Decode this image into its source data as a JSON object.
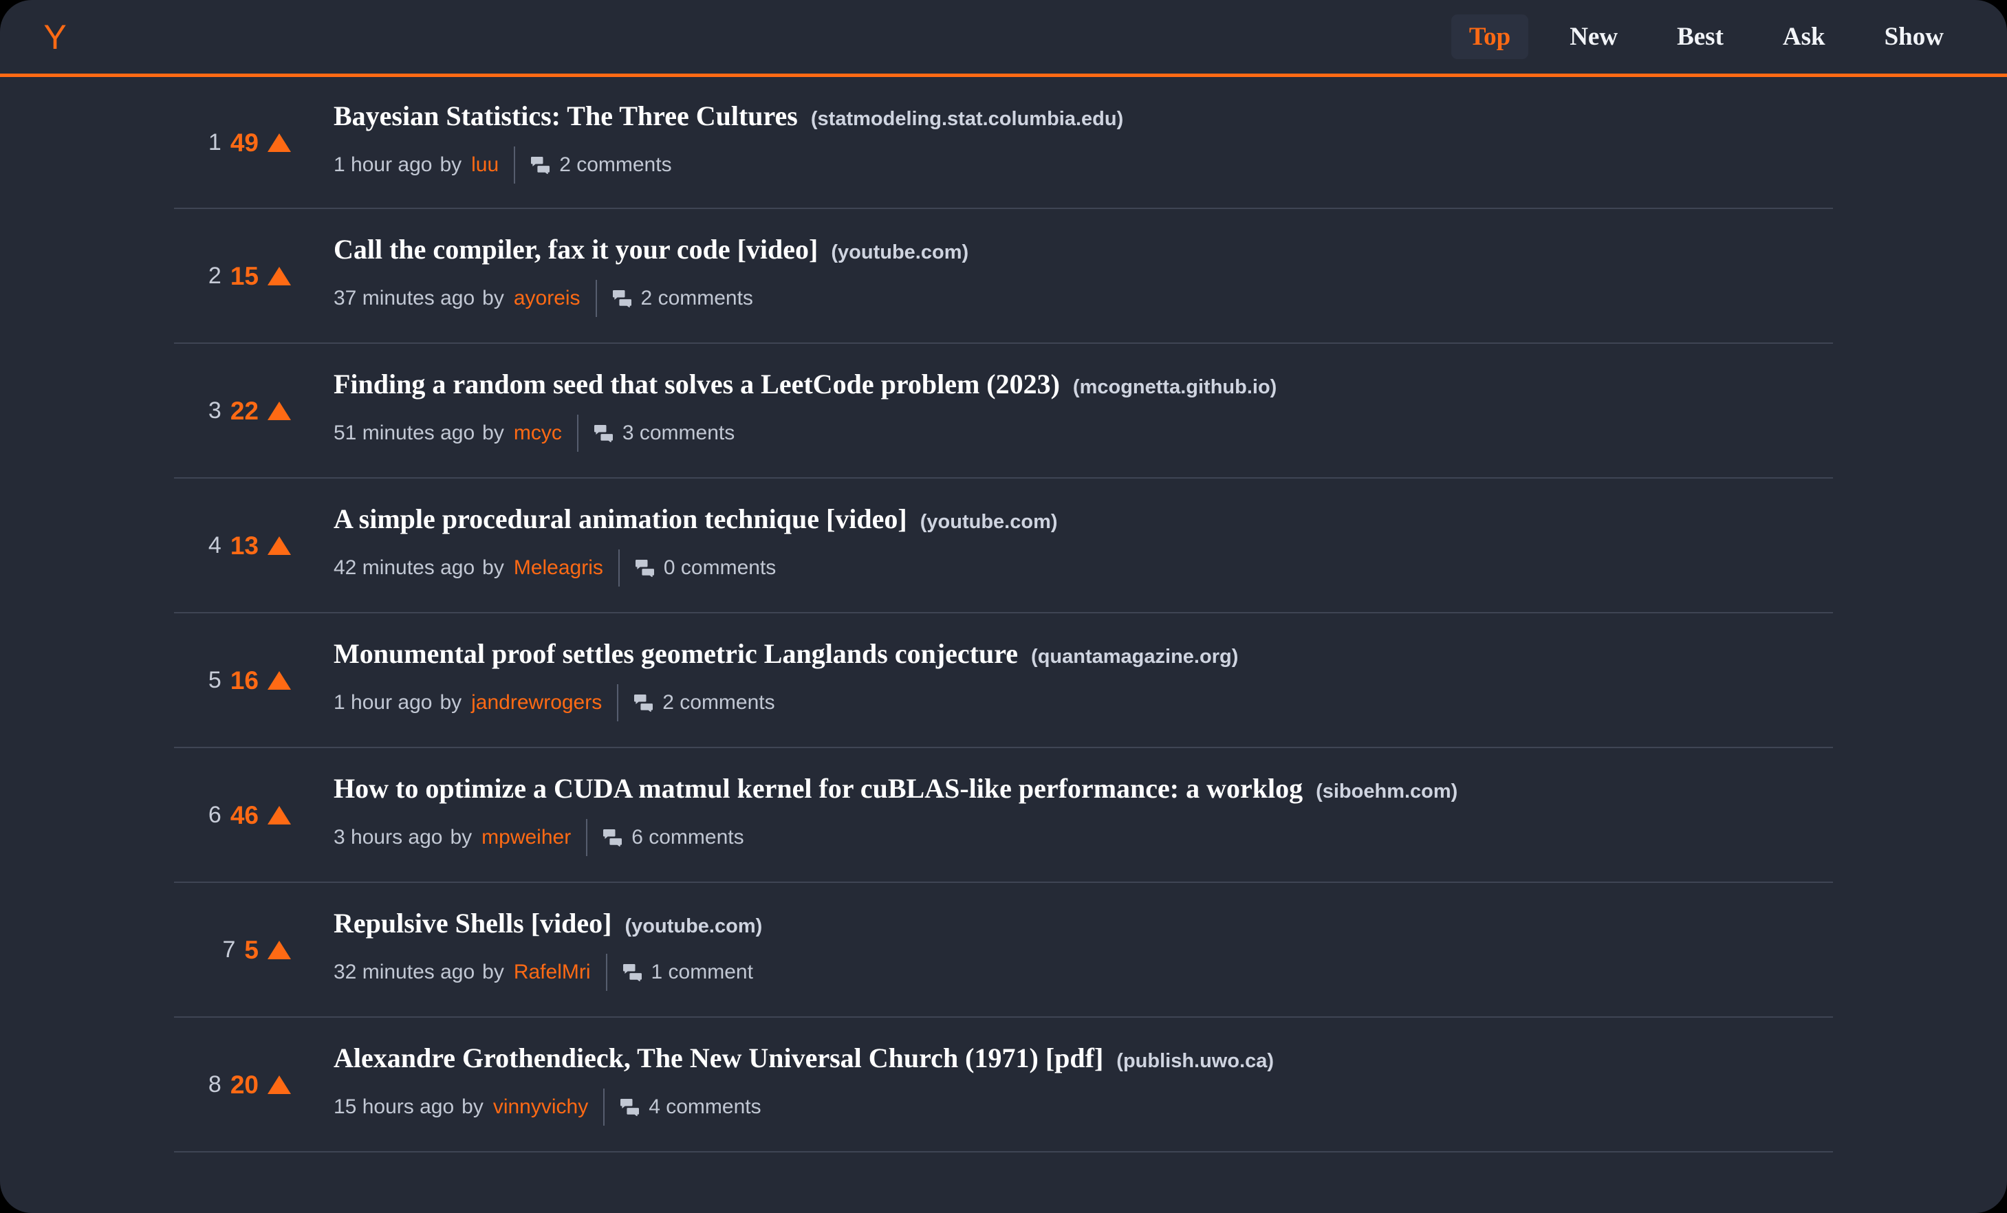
{
  "header": {
    "logo_text": "Y",
    "logo_name": "y-combinator-logo",
    "accent_color": "#ff6a14",
    "nav": [
      {
        "label": "Top",
        "active": true
      },
      {
        "label": "New",
        "active": false
      },
      {
        "label": "Best",
        "active": false
      },
      {
        "label": "Ask",
        "active": false
      },
      {
        "label": "Show",
        "active": false
      }
    ]
  },
  "colors": {
    "background": "#252a36",
    "accent": "#ff6a14",
    "title": "#ffffff",
    "domain": "#cfd4e0",
    "meta": "#c2c8d4",
    "divider": "#3f4554"
  },
  "stories": [
    {
      "rank": "1",
      "score": "49",
      "title": "Bayesian Statistics: The Three Cultures",
      "domain": "(statmodeling.stat.columbia.edu)",
      "time": "1 hour ago",
      "by": "by",
      "user": "luu",
      "comments": "2 comments"
    },
    {
      "rank": "2",
      "score": "15",
      "title": "Call the compiler, fax it your code [video]",
      "domain": "(youtube.com)",
      "time": "37 minutes ago",
      "by": "by",
      "user": "ayoreis",
      "comments": "2 comments"
    },
    {
      "rank": "3",
      "score": "22",
      "title": "Finding a random seed that solves a LeetCode problem (2023)",
      "domain": "(mcognetta.github.io)",
      "time": "51 minutes ago",
      "by": "by",
      "user": "mcyc",
      "comments": "3 comments"
    },
    {
      "rank": "4",
      "score": "13",
      "title": "A simple procedural animation technique [video]",
      "domain": "(youtube.com)",
      "time": "42 minutes ago",
      "by": "by",
      "user": "Meleagris",
      "comments": "0 comments"
    },
    {
      "rank": "5",
      "score": "16",
      "title": "Monumental proof settles geometric Langlands conjecture",
      "domain": "(quantamagazine.org)",
      "time": "1 hour ago",
      "by": "by",
      "user": "jandrewrogers",
      "comments": "2 comments"
    },
    {
      "rank": "6",
      "score": "46",
      "title": "How to optimize a CUDA matmul kernel for cuBLAS-like performance: a worklog",
      "domain": "(siboehm.com)",
      "time": "3 hours ago",
      "by": "by",
      "user": "mpweiher",
      "comments": "6 comments"
    },
    {
      "rank": "7",
      "score": "5",
      "title": "Repulsive Shells [video]",
      "domain": "(youtube.com)",
      "time": "32 minutes ago",
      "by": "by",
      "user": "RafelMri",
      "comments": "1 comment"
    },
    {
      "rank": "8",
      "score": "20",
      "title": "Alexandre Grothendieck, The New Universal Church (1971) [pdf]",
      "domain": "(publish.uwo.ca)",
      "time": "15 hours ago",
      "by": "by",
      "user": "vinnyvichy",
      "comments": "4 comments"
    }
  ]
}
